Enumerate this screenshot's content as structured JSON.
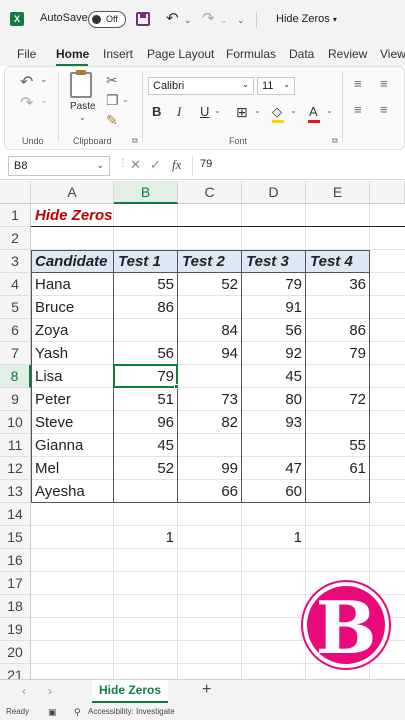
{
  "titlebar": {
    "app_icon": "X",
    "autosave_label": "AutoSave",
    "autosave_state": "Off",
    "doc_title": "Hide Zeros",
    "icons": [
      "excel-logo-icon",
      "save-icon",
      "undo-icon",
      "redo-icon",
      "customize-icon"
    ]
  },
  "menu": {
    "items": [
      "File",
      "Home",
      "Insert",
      "Page Layout",
      "Formulas",
      "Data",
      "Review",
      "View"
    ],
    "active": "Home"
  },
  "ribbon": {
    "paste_label": "Paste",
    "undo_group": "Undo",
    "clipboard_group": "Clipboard",
    "font_group": "Font",
    "font_name": "Calibri",
    "font_size": "11",
    "bold": "B",
    "italic": "I",
    "underline": "U",
    "font_color_char": "A",
    "colors": {
      "font_color": "#e81123",
      "fill_color": "#ffd400"
    }
  },
  "formula_bar": {
    "name_box": "B8",
    "cancel_glyph": "✕",
    "enter_glyph": "✓",
    "fx": "fx",
    "value": "79"
  },
  "grid": {
    "columns": [
      "A",
      "B",
      "C",
      "D",
      "E"
    ],
    "selected_column": "B",
    "selected_row": 8,
    "rows": [
      "1",
      "2",
      "3",
      "4",
      "5",
      "6",
      "7",
      "8",
      "9",
      "10",
      "11",
      "12",
      "13",
      "14",
      "15",
      "16",
      "17",
      "18",
      "19",
      "20",
      "21"
    ],
    "title": "Hide Zeros",
    "headers": [
      "Candidate",
      "Test 1",
      "Test 2",
      "Test 3",
      "Test 4"
    ],
    "data": [
      [
        "Hana",
        "55",
        "52",
        "79",
        "36"
      ],
      [
        "Bruce",
        "86",
        "",
        "91",
        ""
      ],
      [
        "Zoya",
        "",
        "84",
        "56",
        "86"
      ],
      [
        "Yash",
        "56",
        "94",
        "92",
        "79"
      ],
      [
        "Lisa",
        "79",
        "",
        "45",
        ""
      ],
      [
        "Peter",
        "51",
        "73",
        "80",
        "72"
      ],
      [
        "Steve",
        "96",
        "82",
        "93",
        ""
      ],
      [
        "Gianna",
        "45",
        "",
        "",
        "55"
      ],
      [
        "Mel",
        "52",
        "99",
        "47",
        "61"
      ],
      [
        "Ayesha",
        "",
        "66",
        "60",
        ""
      ]
    ],
    "row15": [
      "",
      "1",
      "",
      "1",
      ""
    ]
  },
  "logo": {
    "letter": "B",
    "color": "#e8097a"
  },
  "sheet_tabs": {
    "prev": "‹",
    "next": "›",
    "active": "Hide Zeros",
    "add": "+"
  },
  "status": {
    "ready": "Ready",
    "accessibility": "Accessibility: Investigate"
  }
}
